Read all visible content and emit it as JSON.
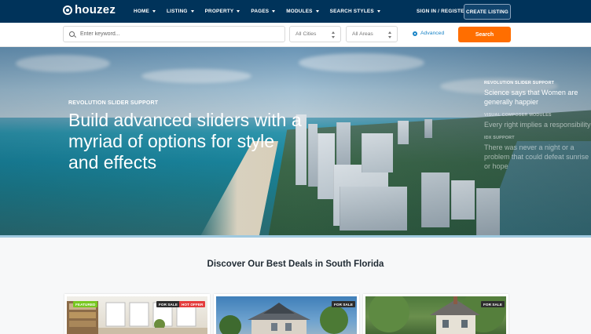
{
  "header": {
    "logo_text": "houzez",
    "nav": [
      "HOME",
      "LISTING",
      "PROPERTY",
      "PAGES",
      "MODULES",
      "SEARCH STYLES"
    ],
    "signin_label": "SIGN IN / REGISTER",
    "create_label": "CREATE LISTING"
  },
  "search": {
    "keyword_placeholder": "Enter keyword...",
    "cities": "All Cities",
    "areas": "All Areas",
    "advanced_label": "Advanced",
    "search_label": "Search"
  },
  "hero": {
    "kicker": "REVOLUTION SLIDER SUPPORT",
    "title": "Build advanced sliders with a myriad of options for style and effects",
    "side_items": [
      {
        "kicker": "REVOLUTION SLIDER SUPPORT",
        "text": "Science says that Women are generally happier"
      },
      {
        "kicker": "VISUAL COMPOSER MODULES",
        "text": "Every right implies a responsibility"
      },
      {
        "kicker": "IDX SUPPORT",
        "text": "There was never a night or a problem that could defeat sunrise or hope"
      }
    ]
  },
  "deals": {
    "title": "Discover Our Best Deals in South Florida",
    "cards": [
      {
        "badges": [
          "FEATURED",
          "FOR SALE",
          "HOT OFFER"
        ]
      },
      {
        "badges": [
          "FOR SALE"
        ]
      },
      {
        "badges": [
          "FOR SALE"
        ]
      }
    ]
  }
}
